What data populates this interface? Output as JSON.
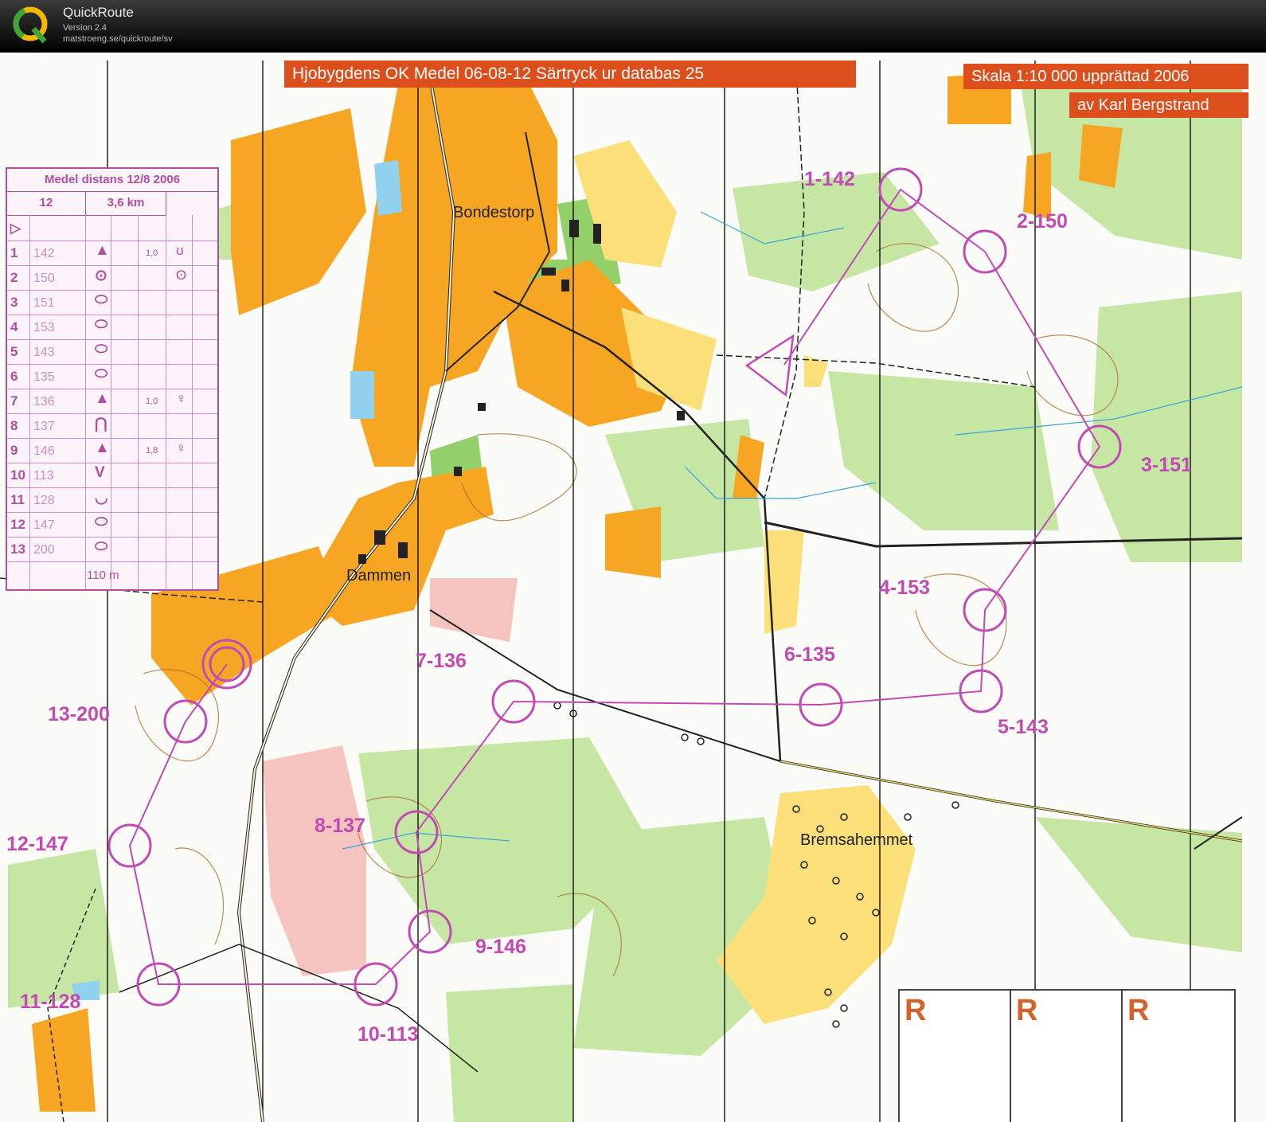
{
  "app": {
    "name": "QuickRoute",
    "version": "Version 2.4",
    "url": "matstroeng.se/quickroute/sv"
  },
  "map": {
    "title_banner": "Hjobygdens OK Medel 06-08-12 Särtryck ur databas  25",
    "scale_banner_line1": "Skala 1:10 000 upprättad 2006",
    "scale_banner_line2": "av Karl Bergstrand",
    "place_names": [
      "Bondestorp",
      "Dammen",
      "Bremsahemmet"
    ],
    "colors": {
      "course": "#c24ab4",
      "open_land": "#f6a623",
      "rough_open": "#fde47a",
      "forest_green": "#bde39b",
      "dense_green": "#8ccc66",
      "water": "#8fd1ef",
      "banner": "#dc4f1c",
      "contour": "#b26f2a"
    }
  },
  "course_table": {
    "title": "Medel distans 12/8 2006",
    "course_number": "12",
    "length": "3,6 km",
    "start_symbol": "▷",
    "rows": [
      {
        "num": "1",
        "code": "142",
        "what": "▲",
        "dim": "1,0",
        "where": "ʊ"
      },
      {
        "num": "2",
        "code": "150",
        "what": "⊙",
        "dim": "",
        "where": "ʘ"
      },
      {
        "num": "3",
        "code": "151",
        "what": "⬭",
        "dim": "",
        "where": ""
      },
      {
        "num": "4",
        "code": "153",
        "what": "⬭",
        "dim": "",
        "where": ""
      },
      {
        "num": "5",
        "code": "143",
        "what": "⬭",
        "dim": "",
        "where": ""
      },
      {
        "num": "6",
        "code": "135",
        "what": "⬭",
        "dim": "",
        "where": ""
      },
      {
        "num": "7",
        "code": "136",
        "what": "▲",
        "dim": "1,0",
        "where": "♀"
      },
      {
        "num": "8",
        "code": "137",
        "what": "⋂",
        "dim": "",
        "where": ""
      },
      {
        "num": "9",
        "code": "146",
        "what": "▲",
        "dim": "1,8",
        "where": "♀"
      },
      {
        "num": "10",
        "code": "113",
        "what": "V",
        "dim": "",
        "where": ""
      },
      {
        "num": "11",
        "code": "128",
        "what": "◡",
        "dim": "",
        "where": ""
      },
      {
        "num": "12",
        "code": "147",
        "what": "⬭",
        "dim": "",
        "where": ""
      },
      {
        "num": "13",
        "code": "200",
        "what": "⬭",
        "dim": "",
        "where": ""
      }
    ],
    "finish_distance": "110 m"
  },
  "controls": [
    {
      "label": "1-142"
    },
    {
      "label": "2-150"
    },
    {
      "label": "3-151"
    },
    {
      "label": "4-153"
    },
    {
      "label": "5-143"
    },
    {
      "label": "6-135"
    },
    {
      "label": "7-136"
    },
    {
      "label": "8-137"
    },
    {
      "label": "9-146"
    },
    {
      "label": "10-113"
    },
    {
      "label": "11-128"
    },
    {
      "label": "12-147"
    },
    {
      "label": "13-200"
    }
  ],
  "r_box": {
    "letters": [
      "R",
      "R",
      "R"
    ]
  }
}
